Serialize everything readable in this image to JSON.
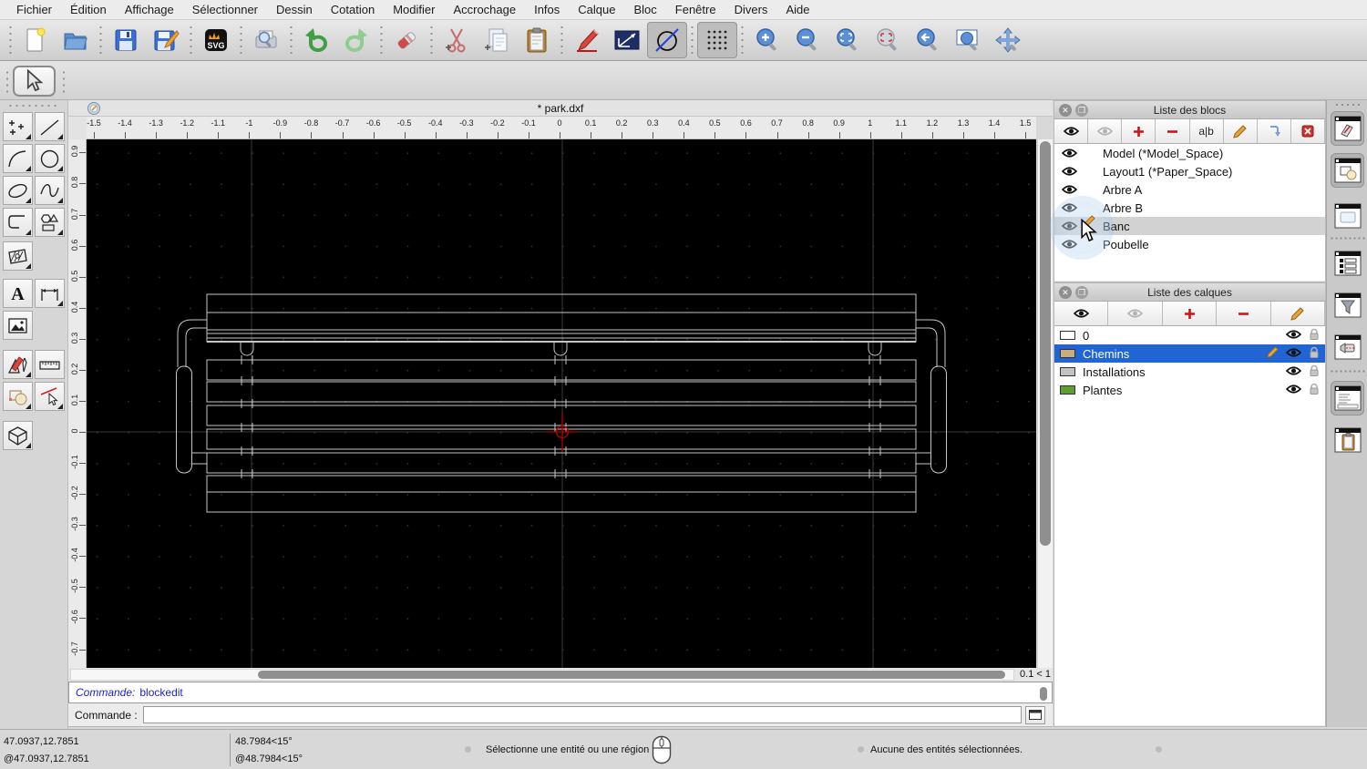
{
  "menu_bar": {
    "items": [
      "Fichier",
      "Édition",
      "Affichage",
      "Sélectionner",
      "Dessin",
      "Cotation",
      "Modifier",
      "Accrochage",
      "Infos",
      "Calque",
      "Bloc",
      "Fenêtre",
      "Divers",
      "Aide"
    ]
  },
  "main_toolbar": {
    "icons": [
      "new-document",
      "open-file",
      "save",
      "save-as",
      "svg-export",
      "print-preview",
      "undo",
      "redo",
      "delete-eraser",
      "cut",
      "copy",
      "paste",
      "draw-pencil",
      "ortho-line",
      "isometric-circle",
      "grid-toggle",
      "zoom-in",
      "zoom-out",
      "zoom-auto",
      "zoom-selection",
      "zoom-previous",
      "zoom-window",
      "pan"
    ]
  },
  "tool_palette": {
    "icons": [
      "select-arrow",
      "points",
      "line",
      "arc",
      "circle",
      "ellipse",
      "spline",
      "polyline",
      "shapes",
      "hatch",
      "text",
      "dimension",
      "image",
      "draw-tools",
      "measure",
      "modify",
      "select-entity",
      "solid-3d"
    ]
  },
  "document": {
    "title": "* park.dxf",
    "zoom_indicator": "0.1 < 1"
  },
  "rulers": {
    "h_labels": [
      "-1.5",
      "-1.4",
      "-1.3",
      "-1.2",
      "-1.1",
      "-1",
      "-0.9",
      "-0.8",
      "-0.7",
      "-0.6",
      "-0.5",
      "-0.4",
      "-0.3",
      "-0.2",
      "-0.1",
      "0",
      "0.1",
      "0.2",
      "0.3",
      "0.4",
      "0.5",
      "0.6",
      "0.7",
      "0.8",
      "0.9",
      "1",
      "1.1",
      "1.2",
      "1.3",
      "1.4",
      "1.5"
    ],
    "v_labels": [
      "0.9",
      "0.8",
      "0.7",
      "0.6",
      "0.5",
      "0.4",
      "0.3",
      "0.2",
      "0.1",
      "0",
      "-0.1",
      "-0.2",
      "-0.3",
      "-0.4",
      "-0.5",
      "-0.6",
      "-0.7"
    ]
  },
  "blocks_panel": {
    "title": "Liste des blocs",
    "toolbar_icons": [
      "show-all-blocks",
      "hide-all-blocks",
      "add-block",
      "remove-block",
      "rename-block",
      "edit-block",
      "insert-block",
      "delete-block"
    ],
    "rename_label": "a|b",
    "items": [
      {
        "name": "Model (*Model_Space)",
        "selected": false,
        "editing": false
      },
      {
        "name": "Layout1 (*Paper_Space)",
        "selected": false,
        "editing": false
      },
      {
        "name": "Arbre A",
        "selected": false,
        "editing": false
      },
      {
        "name": "Arbre B",
        "selected": false,
        "editing": false
      },
      {
        "name": "Banc",
        "selected": true,
        "editing": true
      },
      {
        "name": "Poubelle",
        "selected": false,
        "editing": false
      }
    ]
  },
  "layers_panel": {
    "title": "Liste des calques",
    "toolbar_icons": [
      "show-all-layers",
      "hide-all-layers",
      "add-layer",
      "remove-layer",
      "edit-layer"
    ],
    "selection_color": "#2165d4",
    "layers": [
      {
        "name": "0",
        "color": "#ffffff",
        "selected": false,
        "editing": false
      },
      {
        "name": "Chemins",
        "color": "#c9ad7c",
        "selected": true,
        "editing": true
      },
      {
        "name": "Installations",
        "color": "#c2c2c2",
        "selected": false,
        "editing": false
      },
      {
        "name": "Plantes",
        "color": "#5f9e30",
        "selected": false,
        "editing": false
      }
    ]
  },
  "right_strip": {
    "icons": [
      "block-list-widget",
      "layer-list-widget",
      "library-browser-widget",
      "entity-list-widget",
      "layer-filter-widget",
      "named-views-widget",
      "command-widget",
      "clipboard-widget"
    ]
  },
  "command_area": {
    "history_label": "Commande:",
    "history_command": "blockedit",
    "prompt_label": "Commande :",
    "input_value": ""
  },
  "status_bar": {
    "abs_coord": "47.0937,12.7851",
    "rel_coord": "@47.0937,12.7851",
    "abs_polar": "48.7984<15°",
    "rel_polar": "@48.7984<15°",
    "hint": "Sélectionne une entité ou une région",
    "selection_info": "Aucune des entités sélectionnées."
  },
  "drawing": {
    "crosshair_color": "#b40000",
    "line_color": "#c6c6c6",
    "guide_color": "#3a3a3a"
  }
}
